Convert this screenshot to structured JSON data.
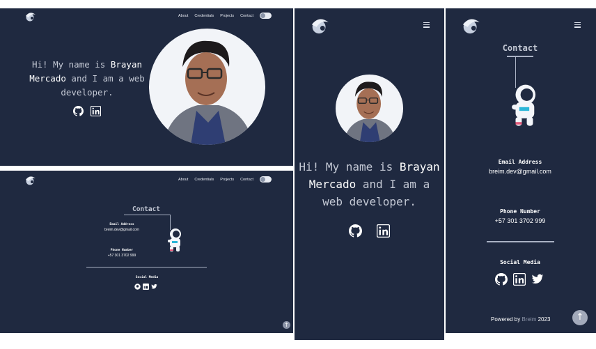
{
  "nav": {
    "about": "About",
    "credentials": "Credentials",
    "projects": "Projects",
    "contact": "Contact"
  },
  "hero": {
    "line_prefix": "Hi! My name is",
    "name_first": "Brayan",
    "name_last": "Mercado",
    "line_suffix": "and I am a web developer.",
    "mobile_suffix_1": "and I am a",
    "mobile_suffix_2": "web developer."
  },
  "contact": {
    "title": "Contact",
    "email_label": "Email Address",
    "email_value": "breim.dev@gmail.com",
    "phone_label": "Phone Number",
    "phone_value": "+57 301 3702 999",
    "social_label": "Social Media"
  },
  "footer": {
    "powered_prefix": "Powered by",
    "powered_brand": "Breim",
    "year": "2023"
  },
  "icons": [
    "logo-icon",
    "github-icon",
    "linkedin-icon",
    "twitter-icon",
    "menu-icon",
    "theme-toggle",
    "scroll-top-icon",
    "astronaut-illustration",
    "profile-photo"
  ],
  "colors": {
    "background": "#1f2940",
    "text_muted": "#c3c8d4",
    "text_bright": "#ffffff",
    "brand_link": "#8b93a7"
  }
}
